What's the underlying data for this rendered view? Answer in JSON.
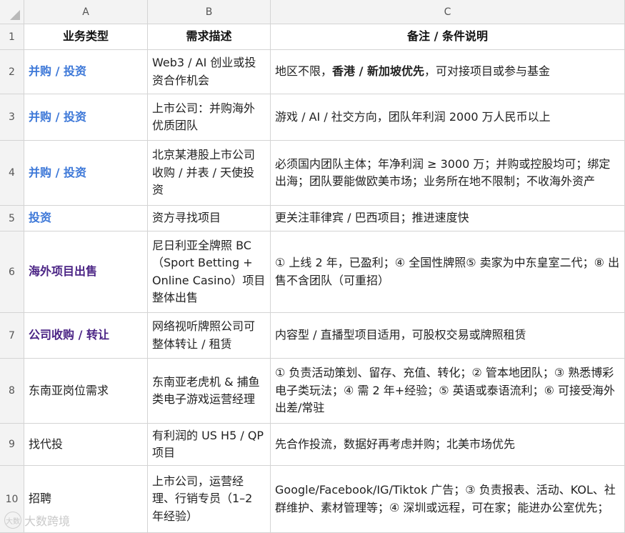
{
  "columns": [
    "A",
    "B",
    "C"
  ],
  "header_row": {
    "num": "1",
    "a": "业务类型",
    "b": "需求描述",
    "c_parts": [
      "备注 / 条件说明"
    ]
  },
  "rows": [
    {
      "num": "2",
      "a": "并购 / 投资",
      "a_style": "blue",
      "b": "Web3 / AI 创业或投资合作机会",
      "c_parts": [
        "地区不限，",
        "香港 / 新加坡优先",
        "，可对接项目或参与基金"
      ]
    },
    {
      "num": "3",
      "a": "并购 / 投资",
      "a_style": "blue",
      "b": "上市公司：并购海外优质团队",
      "c_parts": [
        "游戏 / AI / 社交方向，团队年利润 2000 万人民币以上"
      ]
    },
    {
      "num": "4",
      "a": "并购 / 投资",
      "a_style": "blue",
      "b": "北京某港股上市公司收购 / 并表 / 天使投资",
      "c_parts": [
        "必须国内团队主体；年净利润 ≥ 3000 万；并购或控股均可；绑定出海；团队要能做欧美市场；业务所在地不限制；不收海外资产"
      ]
    },
    {
      "num": "5",
      "a": "投资",
      "a_style": "blue",
      "b": "资方寻找项目",
      "c_parts": [
        "更关注菲律宾 / 巴西项目；推进速度快"
      ]
    },
    {
      "num": "6",
      "a": "海外项目出售",
      "a_style": "purple",
      "b": "尼日利亚全牌照 BC（Sport Betting + Online Casino）项目整体出售",
      "c_parts": [
        "① 上线 2 年，已盈利；④ 全国性牌照⑤ 卖家为中东皇室二代；⑧ 出售不含团队（可重招）"
      ]
    },
    {
      "num": "7",
      "a": "公司收购 / 转让",
      "a_style": "purple",
      "b": "网络视听牌照公司可整体转让 / 租赁",
      "c_parts": [
        "内容型 / 直播型项目适用，可股权交易或牌照租赁"
      ]
    },
    {
      "num": "8",
      "a": "东南亚岗位需求",
      "a_style": "plain",
      "b": "东南亚老虎机 & 捕鱼类电子游戏运营经理",
      "c_parts": [
        "① 负责活动策划、留存、充值、转化；② 管本地团队；③ 熟悉博彩电子类玩法；④ 需 2 年+经验；⑤ 英语或泰语流利；⑥ 可接受海外出差/常驻"
      ]
    },
    {
      "num": "9",
      "a": "找代投",
      "a_style": "plain",
      "b": "有利润的 US H5 / QP 项目",
      "c_parts": [
        "先合作投流，数据好再考虑并购；北美市场优先"
      ]
    },
    {
      "num": "10",
      "a": "招聘",
      "a_style": "plain",
      "b": "上市公司，运营经理、行销专员（1–2 年经验）",
      "c_parts": [
        "Google/Facebook/IG/Tiktok 广告；③ 负责报表、活动、KOL、社群维护、素材管理等；④ 深圳或远程，可在家；能进办公室优先；"
      ]
    }
  ],
  "watermark": {
    "logo_text": "大数",
    "text": "大数跨境"
  },
  "colors": {
    "blue": "#3d78d8",
    "purple": "#4b2485",
    "grid": "#d4d4d4",
    "header_bg": "#f3f3f3"
  }
}
